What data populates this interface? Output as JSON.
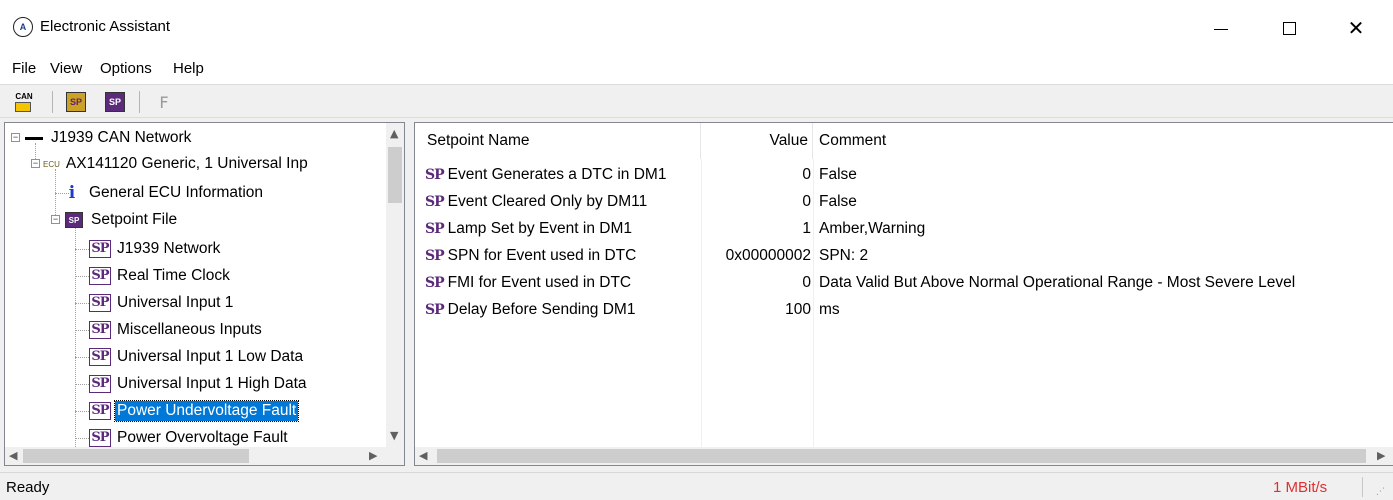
{
  "window": {
    "title": "Electronic Assistant",
    "minimize_glyph": "—",
    "maximize_glyph": "☐",
    "close_glyph": "✕"
  },
  "menu": [
    "File",
    "View",
    "Options",
    "Help"
  ],
  "toolbar": {
    "can_label": "CAN",
    "sp_label": "SP",
    "f_label": "F"
  },
  "tree": {
    "network": "J1939 CAN Network",
    "ecu_tag": "ECU",
    "ecu": "AX141120 Generic, 1 Universal Inp",
    "general_info_icon": "i",
    "general_info": "General ECU Information",
    "setpoint_file_icon": "SP",
    "setpoint_file": "Setpoint File",
    "sp_icon": "SP",
    "items": [
      "J1939 Network",
      "Real Time Clock",
      "Universal Input 1",
      "Miscellaneous Inputs",
      "Universal Input 1 Low Data",
      "Universal Input 1 High Data",
      "Power Undervoltage Fault",
      "Power Overvoltage Fault"
    ],
    "selected_index": 6
  },
  "table": {
    "columns": [
      "Setpoint Name",
      "Value",
      "Comment"
    ],
    "sp_icon": "SP",
    "rows": [
      {
        "name": "Event Generates a DTC in DM1",
        "value": "0",
        "comment": "False"
      },
      {
        "name": "Event Cleared Only by DM11",
        "value": "0",
        "comment": "False"
      },
      {
        "name": "Lamp Set by Event in DM1",
        "value": "1",
        "comment": "Amber,Warning"
      },
      {
        "name": "SPN for Event used in DTC",
        "value": "0x00000002",
        "comment": "SPN: 2"
      },
      {
        "name": "FMI for Event used in DTC",
        "value": "0",
        "comment": "Data Valid But Above Normal Operational Range - Most Severe Level"
      },
      {
        "name": "Delay Before Sending DM1",
        "value": "100",
        "comment": "ms"
      }
    ]
  },
  "status": {
    "text": "Ready",
    "baud": "1 MBit/s"
  },
  "colors": {
    "selection": "#0078d7",
    "setpoint_purple": "#5b2a7a",
    "baud_red": "#e03030"
  }
}
